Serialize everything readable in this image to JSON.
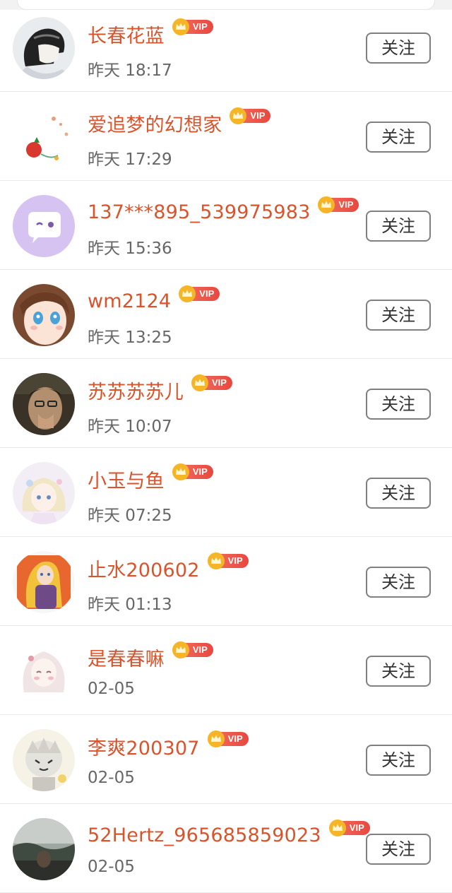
{
  "follow_label": "关注",
  "vip_label": "VIP",
  "users": [
    {
      "name": "长春花蓝",
      "time": "昨天 18:17",
      "avatar_icon": "anime-helmet-avatar-icon"
    },
    {
      "name": "爱追梦的幻想家",
      "time": "昨天 17:29",
      "avatar_icon": "red-flower-avatar-icon"
    },
    {
      "name": "137***895_539975983",
      "time": "昨天 15:36",
      "avatar_icon": "purple-chat-avatar-icon"
    },
    {
      "name": "wm2124",
      "time": "昨天 13:25",
      "avatar_icon": "anime-girl-avatar-icon"
    },
    {
      "name": "苏苏苏苏儿",
      "time": "昨天 10:07",
      "avatar_icon": "photo-person-avatar-icon"
    },
    {
      "name": "小玉与鱼",
      "time": "昨天 07:25",
      "avatar_icon": "pastel-girl-avatar-icon"
    },
    {
      "name": "止水200602",
      "time": "昨天 01:13",
      "avatar_icon": "blonde-girl-avatar-icon"
    },
    {
      "name": "是春春嘛",
      "time": "02-05",
      "avatar_icon": "white-hair-girl-avatar-icon"
    },
    {
      "name": "李爽200307",
      "time": "02-05",
      "avatar_icon": "chibi-boy-avatar-icon"
    },
    {
      "name": "52Hertz_965685859023",
      "time": "02-05",
      "avatar_icon": "landscape-photo-avatar-icon"
    }
  ],
  "colors": {
    "name": "#d9532b",
    "vip_badge": "#e8473f",
    "crown": "#f5b526",
    "time": "#666666",
    "button_border": "#7f7f7f"
  }
}
